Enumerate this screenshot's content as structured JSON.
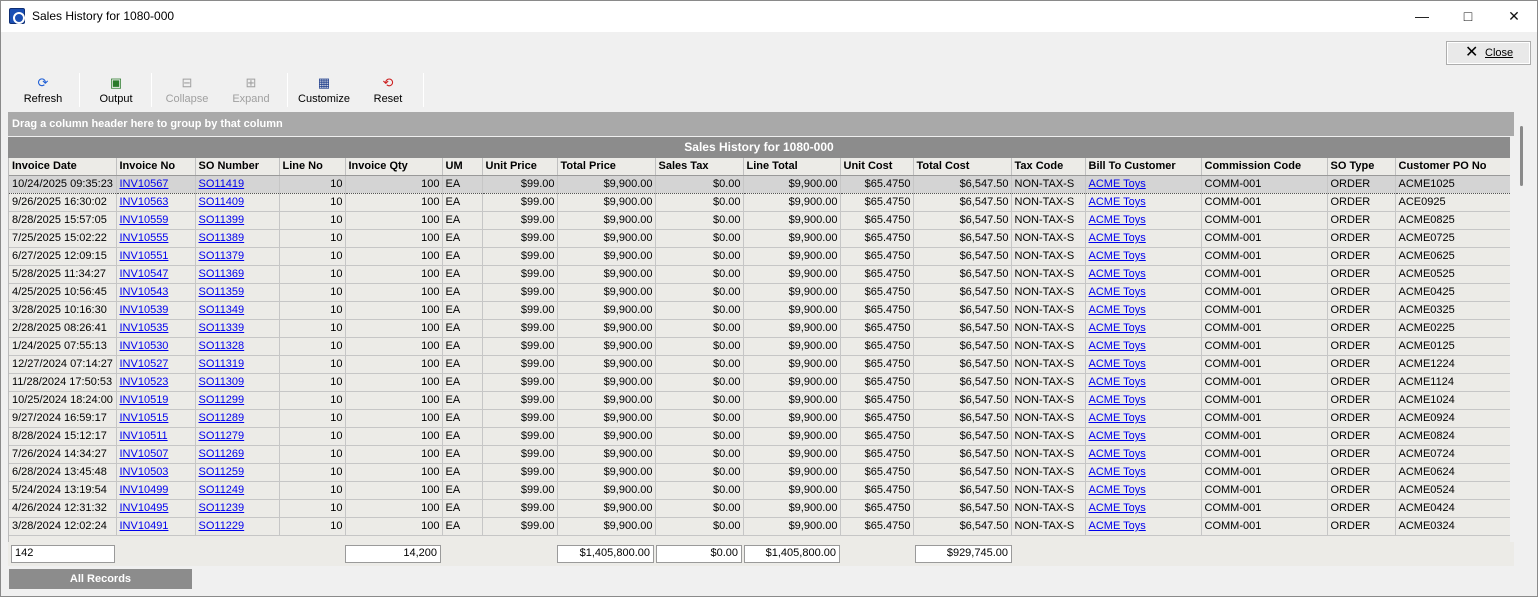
{
  "window": {
    "title": "Sales History for 1080-000",
    "minimize_icon": "minimize-icon",
    "maximize_icon": "maximize-icon",
    "close_icon": "close-icon",
    "close_button_label": "Close"
  },
  "toolbar": {
    "refresh": "Refresh",
    "output": "Output",
    "collapse": "Collapse",
    "expand": "Expand",
    "customize": "Customize",
    "reset": "Reset"
  },
  "grid": {
    "group_hint": "Drag a column header here to group by that column",
    "title": "Sales History for 1080-000",
    "columns": [
      "Invoice Date",
      "Invoice No",
      "SO Number",
      "Line No",
      "Invoice Qty",
      "UM",
      "Unit Price",
      "Total Price",
      "Sales Tax",
      "Line Total",
      "Unit Cost",
      "Total Cost",
      "Tax Code",
      "Bill To Customer",
      "Commission Code",
      "SO Type",
      "Customer PO No"
    ],
    "rows": [
      [
        "10/24/2025 09:35:23",
        "INV10567",
        "SO11419",
        "10",
        "100",
        "EA",
        "$99.00",
        "$9,900.00",
        "$0.00",
        "$9,900.00",
        "$65.4750",
        "$6,547.50",
        "NON-TAX-S",
        "ACME Toys",
        "COMM-001",
        "ORDER",
        "ACME1025"
      ],
      [
        "9/26/2025 16:30:02",
        "INV10563",
        "SO11409",
        "10",
        "100",
        "EA",
        "$99.00",
        "$9,900.00",
        "$0.00",
        "$9,900.00",
        "$65.4750",
        "$6,547.50",
        "NON-TAX-S",
        "ACME Toys",
        "COMM-001",
        "ORDER",
        "ACE0925"
      ],
      [
        "8/28/2025 15:57:05",
        "INV10559",
        "SO11399",
        "10",
        "100",
        "EA",
        "$99.00",
        "$9,900.00",
        "$0.00",
        "$9,900.00",
        "$65.4750",
        "$6,547.50",
        "NON-TAX-S",
        "ACME Toys",
        "COMM-001",
        "ORDER",
        "ACME0825"
      ],
      [
        "7/25/2025 15:02:22",
        "INV10555",
        "SO11389",
        "10",
        "100",
        "EA",
        "$99.00",
        "$9,900.00",
        "$0.00",
        "$9,900.00",
        "$65.4750",
        "$6,547.50",
        "NON-TAX-S",
        "ACME Toys",
        "COMM-001",
        "ORDER",
        "ACME0725"
      ],
      [
        "6/27/2025 12:09:15",
        "INV10551",
        "SO11379",
        "10",
        "100",
        "EA",
        "$99.00",
        "$9,900.00",
        "$0.00",
        "$9,900.00",
        "$65.4750",
        "$6,547.50",
        "NON-TAX-S",
        "ACME Toys",
        "COMM-001",
        "ORDER",
        "ACME0625"
      ],
      [
        "5/28/2025 11:34:27",
        "INV10547",
        "SO11369",
        "10",
        "100",
        "EA",
        "$99.00",
        "$9,900.00",
        "$0.00",
        "$9,900.00",
        "$65.4750",
        "$6,547.50",
        "NON-TAX-S",
        "ACME Toys",
        "COMM-001",
        "ORDER",
        "ACME0525"
      ],
      [
        "4/25/2025 10:56:45",
        "INV10543",
        "SO11359",
        "10",
        "100",
        "EA",
        "$99.00",
        "$9,900.00",
        "$0.00",
        "$9,900.00",
        "$65.4750",
        "$6,547.50",
        "NON-TAX-S",
        "ACME Toys",
        "COMM-001",
        "ORDER",
        "ACME0425"
      ],
      [
        "3/28/2025 10:16:30",
        "INV10539",
        "SO11349",
        "10",
        "100",
        "EA",
        "$99.00",
        "$9,900.00",
        "$0.00",
        "$9,900.00",
        "$65.4750",
        "$6,547.50",
        "NON-TAX-S",
        "ACME Toys",
        "COMM-001",
        "ORDER",
        "ACME0325"
      ],
      [
        "2/28/2025 08:26:41",
        "INV10535",
        "SO11339",
        "10",
        "100",
        "EA",
        "$99.00",
        "$9,900.00",
        "$0.00",
        "$9,900.00",
        "$65.4750",
        "$6,547.50",
        "NON-TAX-S",
        "ACME Toys",
        "COMM-001",
        "ORDER",
        "ACME0225"
      ],
      [
        "1/24/2025 07:55:13",
        "INV10530",
        "SO11328",
        "10",
        "100",
        "EA",
        "$99.00",
        "$9,900.00",
        "$0.00",
        "$9,900.00",
        "$65.4750",
        "$6,547.50",
        "NON-TAX-S",
        "ACME Toys",
        "COMM-001",
        "ORDER",
        "ACME0125"
      ],
      [
        "12/27/2024 07:14:27",
        "INV10527",
        "SO11319",
        "10",
        "100",
        "EA",
        "$99.00",
        "$9,900.00",
        "$0.00",
        "$9,900.00",
        "$65.4750",
        "$6,547.50",
        "NON-TAX-S",
        "ACME Toys",
        "COMM-001",
        "ORDER",
        "ACME1224"
      ],
      [
        "11/28/2024 17:50:53",
        "INV10523",
        "SO11309",
        "10",
        "100",
        "EA",
        "$99.00",
        "$9,900.00",
        "$0.00",
        "$9,900.00",
        "$65.4750",
        "$6,547.50",
        "NON-TAX-S",
        "ACME Toys",
        "COMM-001",
        "ORDER",
        "ACME1124"
      ],
      [
        "10/25/2024 18:24:00",
        "INV10519",
        "SO11299",
        "10",
        "100",
        "EA",
        "$99.00",
        "$9,900.00",
        "$0.00",
        "$9,900.00",
        "$65.4750",
        "$6,547.50",
        "NON-TAX-S",
        "ACME Toys",
        "COMM-001",
        "ORDER",
        "ACME1024"
      ],
      [
        "9/27/2024 16:59:17",
        "INV10515",
        "SO11289",
        "10",
        "100",
        "EA",
        "$99.00",
        "$9,900.00",
        "$0.00",
        "$9,900.00",
        "$65.4750",
        "$6,547.50",
        "NON-TAX-S",
        "ACME Toys",
        "COMM-001",
        "ORDER",
        "ACME0924"
      ],
      [
        "8/28/2024 15:12:17",
        "INV10511",
        "SO11279",
        "10",
        "100",
        "EA",
        "$99.00",
        "$9,900.00",
        "$0.00",
        "$9,900.00",
        "$65.4750",
        "$6,547.50",
        "NON-TAX-S",
        "ACME Toys",
        "COMM-001",
        "ORDER",
        "ACME0824"
      ],
      [
        "7/26/2024 14:34:27",
        "INV10507",
        "SO11269",
        "10",
        "100",
        "EA",
        "$99.00",
        "$9,900.00",
        "$0.00",
        "$9,900.00",
        "$65.4750",
        "$6,547.50",
        "NON-TAX-S",
        "ACME Toys",
        "COMM-001",
        "ORDER",
        "ACME0724"
      ],
      [
        "6/28/2024 13:45:48",
        "INV10503",
        "SO11259",
        "10",
        "100",
        "EA",
        "$99.00",
        "$9,900.00",
        "$0.00",
        "$9,900.00",
        "$65.4750",
        "$6,547.50",
        "NON-TAX-S",
        "ACME Toys",
        "COMM-001",
        "ORDER",
        "ACME0624"
      ],
      [
        "5/24/2024 13:19:54",
        "INV10499",
        "SO11249",
        "10",
        "100",
        "EA",
        "$99.00",
        "$9,900.00",
        "$0.00",
        "$9,900.00",
        "$65.4750",
        "$6,547.50",
        "NON-TAX-S",
        "ACME Toys",
        "COMM-001",
        "ORDER",
        "ACME0524"
      ],
      [
        "4/26/2024 12:31:32",
        "INV10495",
        "SO11239",
        "10",
        "100",
        "EA",
        "$99.00",
        "$9,900.00",
        "$0.00",
        "$9,900.00",
        "$65.4750",
        "$6,547.50",
        "NON-TAX-S",
        "ACME Toys",
        "COMM-001",
        "ORDER",
        "ACME0424"
      ],
      [
        "3/28/2024 12:02:24",
        "INV10491",
        "SO11229",
        "10",
        "100",
        "EA",
        "$99.00",
        "$9,900.00",
        "$0.00",
        "$9,900.00",
        "$65.4750",
        "$6,547.50",
        "NON-TAX-S",
        "ACME Toys",
        "COMM-001",
        "ORDER",
        "ACME0324"
      ]
    ]
  },
  "summary": {
    "record_count": "142",
    "invoice_qty_total": "14,200",
    "total_price_total": "$1,405,800.00",
    "sales_tax_total": "$0.00",
    "line_total_total": "$1,405,800.00",
    "total_cost_total": "$929,745.00"
  },
  "tabs": {
    "all_records": "All Records"
  },
  "colors": {
    "link": "#0000ee",
    "header_gray": "#8c8c8c",
    "grid_bg": "#ecebe7",
    "refresh_icon": "#1f5fd6",
    "reset_icon": "#cc2020"
  }
}
